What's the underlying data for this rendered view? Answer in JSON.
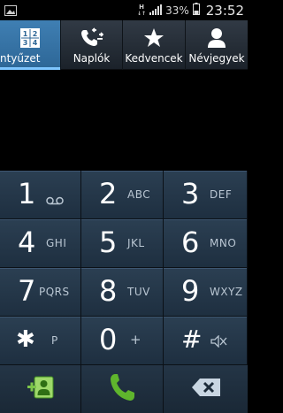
{
  "status_bar": {
    "network_type": "H",
    "battery_percent": "33%",
    "time": "23:52"
  },
  "tabs": [
    {
      "label": "ntyűzet",
      "icon": "dialpad-icon",
      "active": true
    },
    {
      "label": "Naplók",
      "icon": "call-log-icon",
      "active": false
    },
    {
      "label": "Kedvencek",
      "icon": "star-icon",
      "active": false
    },
    {
      "label": "Névjegyek",
      "icon": "contact-icon",
      "active": false
    }
  ],
  "keypad": {
    "k1": {
      "digit": "1",
      "sub": "voicemail-icon"
    },
    "k2": {
      "digit": "2",
      "letters": "ABC"
    },
    "k3": {
      "digit": "3",
      "letters": "DEF"
    },
    "k4": {
      "digit": "4",
      "letters": "GHI"
    },
    "k5": {
      "digit": "5",
      "letters": "JKL"
    },
    "k6": {
      "digit": "6",
      "letters": "MNO"
    },
    "k7": {
      "digit": "7",
      "letters": "PQRS"
    },
    "k8": {
      "digit": "8",
      "letters": "TUV"
    },
    "k9": {
      "digit": "9",
      "letters": "WXYZ"
    },
    "kstar": {
      "digit": "✱",
      "letters": "P"
    },
    "k0": {
      "digit": "0",
      "letters": "+"
    },
    "khash": {
      "digit": "#",
      "sub": "mute-icon"
    }
  },
  "actions": {
    "add_contact": "add-contact-icon",
    "call": "call-icon",
    "delete": "backspace-icon"
  },
  "colors": {
    "active_tab": "#3a78ab",
    "call_green": "#5fb52d"
  }
}
